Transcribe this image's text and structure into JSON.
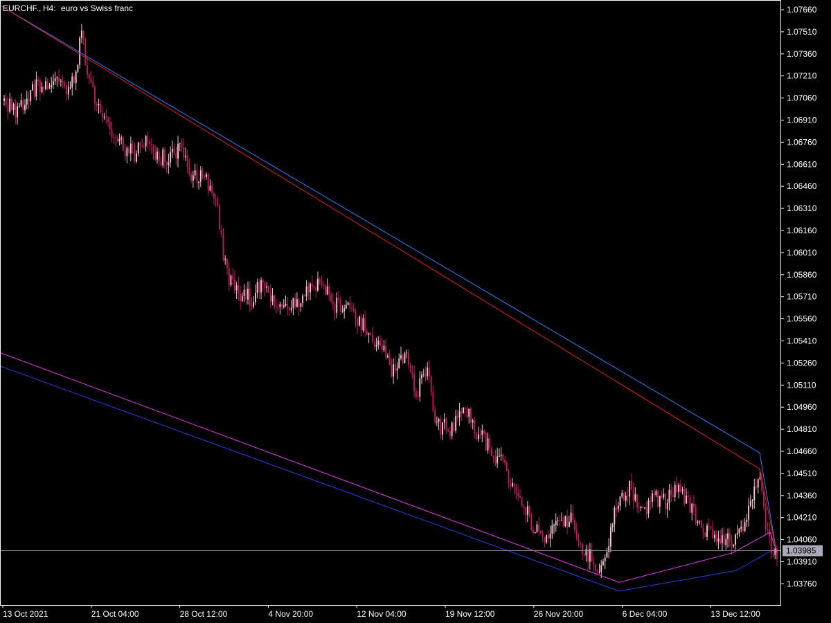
{
  "header": {
    "symbol": "EURCHF.,",
    "timeframe": "H4:",
    "description": "euro vs Swiss franc"
  },
  "price_badge": "1.03985",
  "colors": {
    "background": "#000000",
    "frame": "#ffffff",
    "bull_candle": "#f5c6cb",
    "bear_candle": "#c2185b",
    "upper_outer_channel": "#2f7fff",
    "upper_inner_channel": "#e0211b",
    "lower_inner_channel": "#e040e0",
    "lower_outer_channel": "#2340e0",
    "price_line": "#8c8ca0",
    "badge_bg": "#a9a9b8"
  },
  "chart_data": {
    "type": "candlestick",
    "symbol": "EURCHF.",
    "timeframe": "H4",
    "y_ticks": [
      "1.07660",
      "1.07510",
      "1.07360",
      "1.07210",
      "1.07060",
      "1.06910",
      "1.06760",
      "1.06610",
      "1.06460",
      "1.06310",
      "1.06160",
      "1.06010",
      "1.05860",
      "1.05710",
      "1.05560",
      "1.05410",
      "1.05260",
      "1.05110",
      "1.04960",
      "1.04810",
      "1.04660",
      "1.04510",
      "1.04360",
      "1.04210",
      "1.04060",
      "1.03910",
      "1.03760"
    ],
    "x_ticks": [
      "13 Oct 2021",
      "21 Oct 04:00",
      "28 Oct 12:00",
      "4 Nov 20:00",
      "12 Nov 04:00",
      "19 Nov 12:00",
      "26 Nov 20:00",
      "6 Dec 04:00",
      "13 Dec 12:00"
    ],
    "ylim": [
      1.0368,
      1.0769
    ],
    "n_bars": 410,
    "current_price": 1.03985,
    "price_path": [
      [
        0,
        1.0704
      ],
      [
        10,
        1.0695
      ],
      [
        20,
        1.0708
      ],
      [
        30,
        1.0715
      ],
      [
        40,
        1.0718
      ],
      [
        50,
        1.0711
      ],
      [
        58,
        1.0715
      ],
      [
        62,
        1.073
      ],
      [
        65,
        1.0753
      ],
      [
        70,
        1.0726
      ],
      [
        80,
        1.07
      ],
      [
        90,
        1.0682
      ],
      [
        100,
        1.0673
      ],
      [
        110,
        1.0668
      ],
      [
        120,
        1.068
      ],
      [
        130,
        1.0667
      ],
      [
        140,
        1.0664
      ],
      [
        150,
        1.0672
      ],
      [
        160,
        1.0653
      ],
      [
        170,
        1.0651
      ],
      [
        180,
        1.0638
      ],
      [
        185,
        1.0605
      ],
      [
        190,
        1.0582
      ],
      [
        200,
        1.0573
      ],
      [
        210,
        1.057
      ],
      [
        220,
        1.0585
      ],
      [
        230,
        1.0562
      ],
      [
        240,
        1.0564
      ],
      [
        250,
        1.0568
      ],
      [
        260,
        1.058
      ],
      [
        270,
        1.058
      ],
      [
        280,
        1.0565
      ],
      [
        290,
        1.0563
      ],
      [
        300,
        1.0555
      ],
      [
        310,
        1.0545
      ],
      [
        320,
        1.0535
      ],
      [
        330,
        1.052
      ],
      [
        340,
        1.053
      ],
      [
        350,
        1.0505
      ],
      [
        360,
        1.0525
      ],
      [
        365,
        1.0485
      ],
      [
        380,
        1.048
      ],
      [
        390,
        1.0495
      ],
      [
        400,
        1.048
      ],
      [
        410,
        1.047
      ],
      [
        420,
        1.046
      ],
      [
        430,
        1.0445
      ],
      [
        440,
        1.043
      ],
      [
        450,
        1.0412
      ],
      [
        460,
        1.0408
      ],
      [
        470,
        1.0415
      ],
      [
        480,
        1.0422
      ],
      [
        490,
        1.04
      ],
      [
        500,
        1.0392
      ],
      [
        505,
        1.038
      ],
      [
        510,
        1.04
      ],
      [
        520,
        1.043
      ],
      [
        530,
        1.044
      ],
      [
        540,
        1.0425
      ],
      [
        550,
        1.0435
      ],
      [
        560,
        1.0432
      ],
      [
        570,
        1.044
      ],
      [
        580,
        1.0432
      ],
      [
        590,
        1.0415
      ],
      [
        600,
        1.0412
      ],
      [
        610,
        1.0408
      ],
      [
        620,
        1.0405
      ],
      [
        630,
        1.042
      ],
      [
        635,
        1.044
      ],
      [
        640,
        1.0453
      ],
      [
        645,
        1.042
      ],
      [
        650,
        1.04
      ],
      [
        655,
        1.0398
      ]
    ],
    "channels": [
      {
        "role": "upper-outer",
        "color": "#2f7fff",
        "points": [
          [
            1.0769,
            0
          ],
          [
            1.0465,
            1097
          ],
          [
            1.0396,
            1122
          ]
        ]
      },
      {
        "role": "upper-inner",
        "color": "#e0211b",
        "points": [
          [
            1.0769,
            0
          ],
          [
            1.0454,
            1097
          ],
          [
            1.0396,
            1122
          ]
        ]
      },
      {
        "role": "lower-inner",
        "color": "#e040e0",
        "points": [
          [
            1.0533,
            0
          ],
          [
            1.0377,
            894
          ],
          [
            1.0397,
            1058
          ],
          [
            1.0411,
            1112
          ],
          [
            1.0397,
            1122
          ]
        ]
      },
      {
        "role": "lower-outer",
        "color": "#2340e0",
        "points": [
          [
            1.0524,
            0
          ],
          [
            1.0371,
            894
          ],
          [
            1.0385,
            1063
          ],
          [
            1.0398,
            1112
          ]
        ]
      }
    ]
  }
}
